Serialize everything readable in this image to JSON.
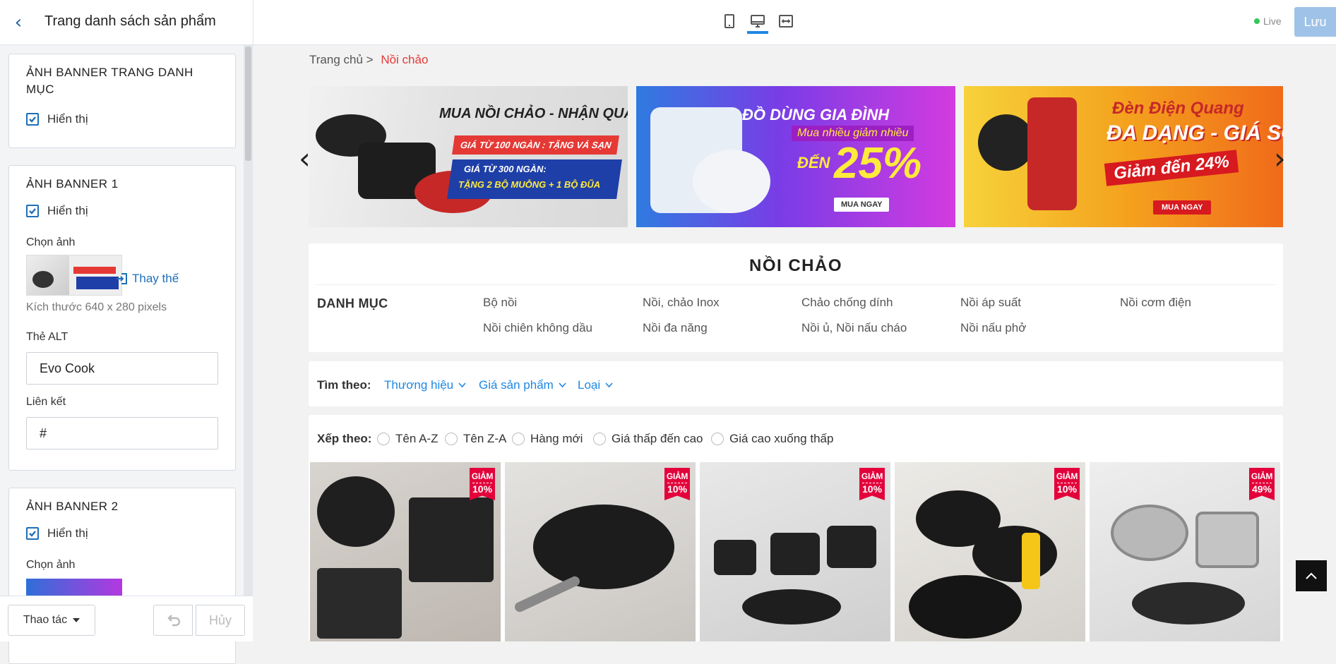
{
  "header": {
    "back_icon": "chevron-left-icon",
    "page_title": "Trang danh sách sản phẩm",
    "device_icons": [
      "mobile-icon",
      "desktop-icon",
      "fullwidth-icon"
    ],
    "live_label": "Live",
    "save_label": "Lưu",
    "colors": {
      "accent": "#1e88e5",
      "save_bg": "#9fc3e8",
      "live_dot": "#34c759",
      "sale": "#e53935"
    }
  },
  "sidebar": {
    "panel_category": {
      "title": "ẢNH BANNER TRANG DANH MỤC",
      "show_label": "Hiển thị",
      "checked": true
    },
    "panel_banner1": {
      "title": "ẢNH BANNER 1",
      "show_label": "Hiển thị",
      "checked": true,
      "choose_label": "Chọn ảnh",
      "replace_label": "Thay thế",
      "size_hint": "Kích thước 640 x 280 pixels",
      "alt_label": "Thẻ ALT",
      "alt_value": "Evo Cook",
      "link_label": "Liên kết",
      "link_value": "#"
    },
    "panel_banner2": {
      "title": "ẢNH BANNER 2",
      "show_label": "Hiển thị",
      "checked": true,
      "choose_label": "Chọn ảnh"
    },
    "footer": {
      "action_label": "Thao tác",
      "undo_icon": "undo-icon",
      "cancel_label": "Hủy"
    }
  },
  "preview": {
    "breadcrumb": {
      "home": "Trang chủ",
      "sep": ">",
      "current": "Nồi chảo"
    },
    "banners": [
      {
        "headline": "MUA NỒI CHẢO - NHẬN QUÀ NGON",
        "line1": "GIÁ TỪ 100 NGÀN : TẶNG VÁ SẠN",
        "line2": "GIÁ TỪ 300 NGÀN:",
        "line3": "TẶNG 2 BỘ MUỖNG + 1 BỘ ĐŨA"
      },
      {
        "headline": "ĐỒ DÙNG GIA ĐÌNH",
        "sub": "Mua nhiều giảm nhiều",
        "prefix": "ĐẾN",
        "big": "25%",
        "cta": "MUA NGAY"
      },
      {
        "brand": "Đèn Điện Quang",
        "headline": "ĐA DẠNG - GIÁ SỐC",
        "sub": "Giảm đến 24%",
        "cta": "MUA NGAY"
      }
    ],
    "category_title": "NỒI CHẢO",
    "category_label": "DANH MỤC",
    "categories": [
      "Bộ nồi",
      "Nồi, chảo Inox",
      "Chảo chống dính",
      "Nồi áp suất",
      "Nồi cơm điện",
      "Nồi chiên không dầu",
      "Nồi đa năng",
      "Nồi ủ, Nồi nấu cháo",
      "Nồi nấu phở"
    ],
    "filter": {
      "label": "Tìm theo:",
      "options": [
        "Thương hiệu",
        "Giá sản phẩm",
        "Loại"
      ]
    },
    "sort": {
      "label": "Xếp theo:",
      "options": [
        "Tên A-Z",
        "Tên Z-A",
        "Hàng mới",
        "Giá thấp đến cao",
        "Giá cao xuống thấp"
      ]
    },
    "products": [
      {
        "badge": "GIẢM",
        "discount": "10%"
      },
      {
        "badge": "GIẢM",
        "discount": "10%"
      },
      {
        "badge": "GIẢM",
        "discount": "10%"
      },
      {
        "badge": "GIẢM",
        "discount": "10%"
      },
      {
        "badge": "GIẢM",
        "discount": "49%"
      }
    ],
    "back_to_top_icon": "chevron-up-icon"
  }
}
